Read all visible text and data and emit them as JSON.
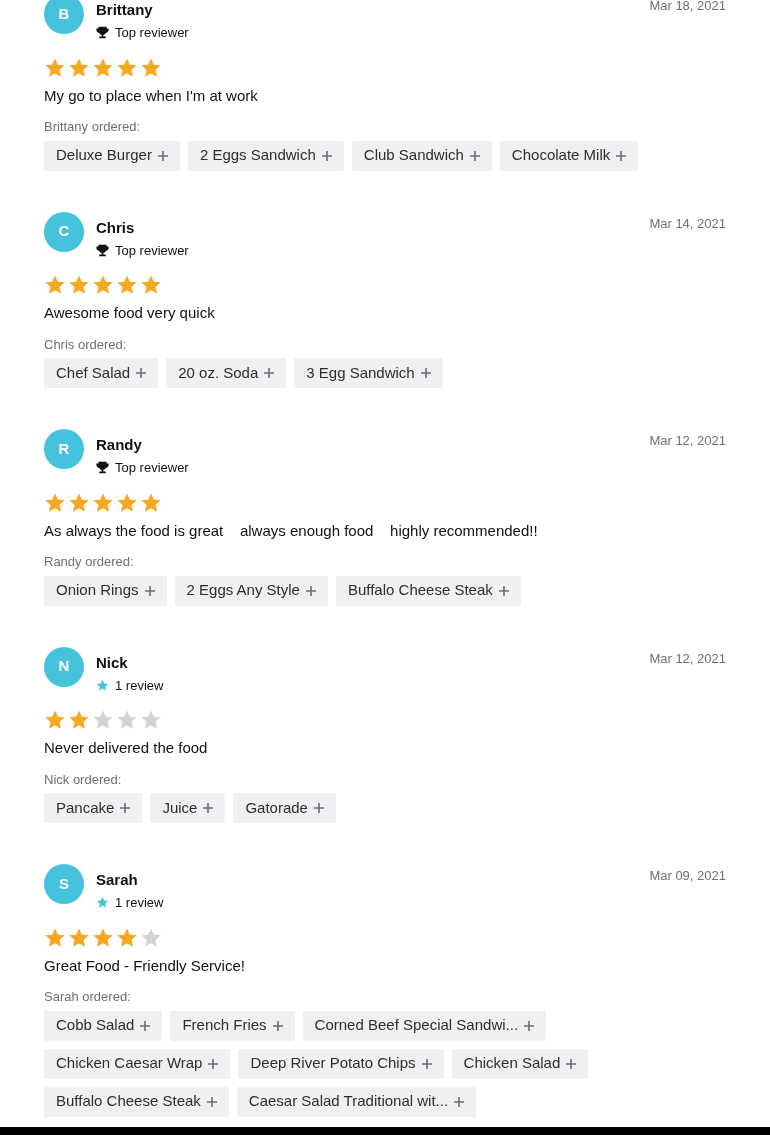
{
  "reviews": [
    {
      "initial": "B",
      "name": "Brittany",
      "badge": {
        "kind": "top_reviewer",
        "label": "Top reviewer"
      },
      "date": "Mar 18, 2021",
      "stars": 5,
      "text": "My go to place when I'm at work",
      "ordered_label": "Brittany ordered:",
      "items": [
        "Deluxe Burger",
        "2 Eggs Sandwich",
        "Club Sandwich",
        "Chocolate Milk"
      ]
    },
    {
      "initial": "C",
      "name": "Chris",
      "badge": {
        "kind": "top_reviewer",
        "label": "Top reviewer"
      },
      "date": "Mar 14, 2021",
      "stars": 5,
      "text": "Awesome food very quick",
      "ordered_label": "Chris ordered:",
      "items": [
        "Chef Salad",
        "20 oz. Soda",
        "3 Egg Sandwich"
      ]
    },
    {
      "initial": "R",
      "name": "Randy",
      "badge": {
        "kind": "top_reviewer",
        "label": "Top reviewer"
      },
      "date": "Mar 12, 2021",
      "stars": 5,
      "text": "As always the food is great    always enough food    highly recommended!!",
      "ordered_label": "Randy ordered:",
      "items": [
        "Onion Rings",
        "2 Eggs Any Style",
        "Buffalo Cheese Steak"
      ]
    },
    {
      "initial": "N",
      "name": "Nick",
      "badge": {
        "kind": "review_count",
        "label": "1 review"
      },
      "date": "Mar 12, 2021",
      "stars": 2,
      "text": "Never delivered the food",
      "ordered_label": "Nick ordered:",
      "items": [
        "Pancake",
        "Juice",
        "Gatorade"
      ]
    },
    {
      "initial": "S",
      "name": "Sarah",
      "badge": {
        "kind": "review_count",
        "label": "1 review"
      },
      "date": "Mar 09, 2021",
      "stars": 4,
      "text": "Great Food - Friendly Service!",
      "ordered_label": "Sarah ordered:",
      "items": [
        "Cobb Salad",
        "French Fries",
        "Corned Beef Special Sandwi...",
        "Chicken Caesar Wrap",
        "Deep River Potato Chips",
        "Chicken Salad",
        "Buffalo Cheese Steak",
        "Caesar Salad Traditional wit..."
      ]
    }
  ]
}
